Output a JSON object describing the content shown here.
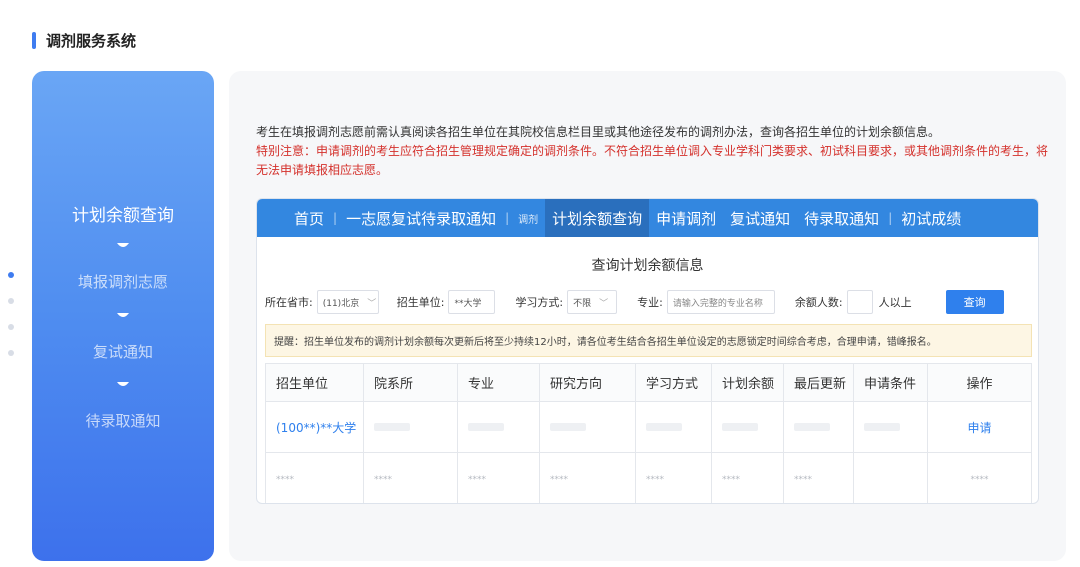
{
  "header": {
    "title": "调剂服务系统"
  },
  "steps": [
    {
      "label": "计划余额查询"
    },
    {
      "label": "填报调剂志愿"
    },
    {
      "label": "复试通知"
    },
    {
      "label": "待录取通知"
    }
  ],
  "intro": {
    "line1": "考生在填报调剂志愿前需认真阅读各招生单位在其院校信息栏目里或其他途径发布的调剂办法，查询各招生单位的计划余额信息。",
    "warning": "特别注意：申请调剂的考生应符合招生管理规定确定的调剂条件。不符合招生单位调入专业学科门类要求、初试科目要求，或其他调剂条件的考生，将无法申请填报相应志愿。"
  },
  "nav": {
    "items": [
      "首页",
      "一志愿复试待录取通知",
      "调剂",
      "计划余额查询",
      "申请调剂",
      "复试通知",
      "待录取通知",
      "初试成绩"
    ],
    "separator": "|"
  },
  "query": {
    "title": "查询计划余额信息",
    "province_label": "所在省市:",
    "province_value": "(11)北京",
    "unit_label": "招生单位:",
    "unit_value": "**大学",
    "mode_label": "学习方式:",
    "mode_value": "不限",
    "major_label": "专业:",
    "major_placeholder": "请输入完整的专业名称",
    "remain_label": "余额人数:",
    "remain_value": "",
    "remain_suffix": "人以上",
    "button": "查询"
  },
  "notice": "提醒：招生单位发布的调剂计划余额每次更新后将至少持续12小时，请各位考生结合各招生单位设定的志愿锁定时间综合考虑，合理申请，错峰报名。",
  "table": {
    "headers": [
      "招生单位",
      "院系所",
      "专业",
      "研究方向",
      "学习方式",
      "计划余额",
      "最后更新",
      "申请条件",
      "操作"
    ],
    "row1": {
      "unit": "(100**)**大学",
      "action": "申请"
    },
    "row2": [
      "****",
      "****",
      "****",
      "****",
      "****",
      "****",
      "****",
      "",
      "****"
    ]
  }
}
